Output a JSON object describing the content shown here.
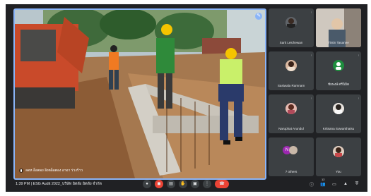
{
  "main": {
    "presenter_name": "ลดห อ็อตอง อิงตอ็อตอง อาอา ร่วงร้าว"
  },
  "participants": [
    {
      "name": "Sarit Leichewan",
      "avatar_color": "#7a6a5e"
    },
    {
      "name": "Tintin Tasanee",
      "avatar_color": "#d8c7b0"
    },
    {
      "name": "Sasiwala Ramnam",
      "avatar_color": "#8d6b5a"
    },
    {
      "name": "ชัยพงษ์ ศรีนิมิต",
      "avatar_color": "#1e8e3e"
    },
    {
      "name": "Naruphat Arundul",
      "avatar_color": "#b9877a"
    },
    {
      "name": "Kritsana Suwanthaisu",
      "avatar_color": "#d8cfc6"
    },
    {
      "name": "7 others",
      "avatar_color": "#9c27b0"
    },
    {
      "name": "You",
      "avatar_color": "#c9a48a"
    }
  ],
  "bottom": {
    "time": "1:39 PM",
    "separator": "|",
    "meeting_title": "ESG Audit 2022_บริษัท อิตลัง อิตลัง จำกัด",
    "people_count": "12"
  },
  "colors": {
    "background": "#202124",
    "tile": "#3c4043",
    "accent": "#8ab4f8",
    "danger": "#ea4335"
  },
  "icons": {
    "mic": "mic-icon",
    "camera": "camera-icon",
    "captions": "captions-icon",
    "raise_hand": "raise-hand-icon",
    "present": "present-icon",
    "more": "more-options-icon",
    "end_call": "end-call-icon",
    "info": "info-icon",
    "people": "people-icon",
    "chat": "chat-icon",
    "activities": "activities-icon",
    "host_controls": "host-controls-icon"
  }
}
